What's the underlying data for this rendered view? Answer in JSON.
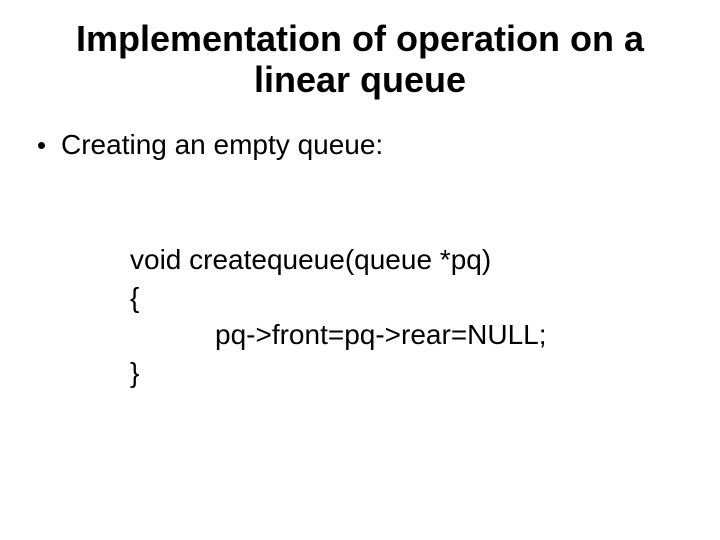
{
  "title_line1": "Implementation of operation on a",
  "title_line2": "linear queue",
  "bullet_text": "Creating an empty queue:",
  "code": {
    "line1": "void createqueue(queue *pq)",
    "line2": "{",
    "line3": "pq->front=pq->rear=NULL;",
    "line4": "}"
  }
}
